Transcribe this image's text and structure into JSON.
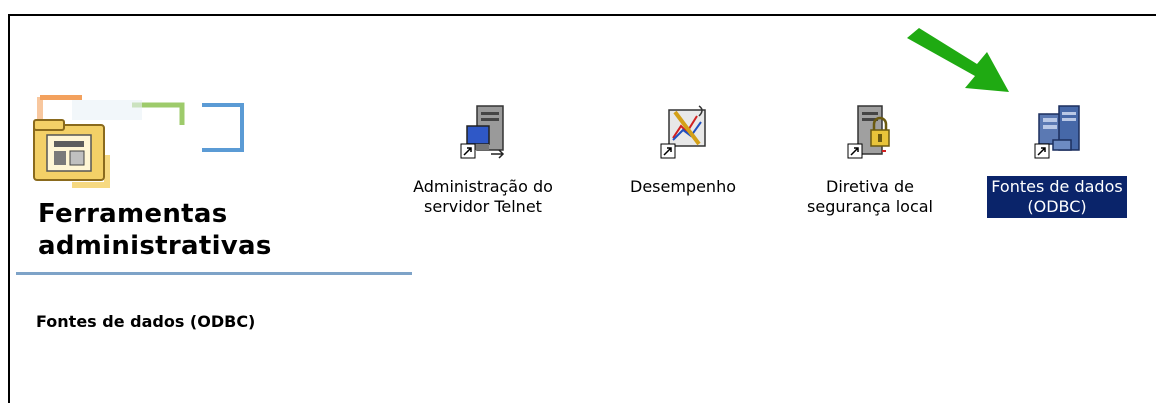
{
  "section": {
    "title_line1": "Ferramentas",
    "title_line2": "administrativas",
    "selected_item_name": "Fontes de dados (ODBC)"
  },
  "items": [
    {
      "label": "Administração do\nservidor Telnet",
      "icon": "telnet-server-icon"
    },
    {
      "label": "Desempenho",
      "icon": "performance-icon"
    },
    {
      "label": "Diretiva de\nsegurança local",
      "icon": "local-security-policy-icon"
    },
    {
      "label": "Fontes de dados\n(ODBC)",
      "icon": "odbc-data-sources-icon",
      "selected": true
    }
  ],
  "colors": {
    "selection_bg": "#0a246a",
    "arrow": "#1faa12",
    "divider": "#7ea3c8"
  }
}
